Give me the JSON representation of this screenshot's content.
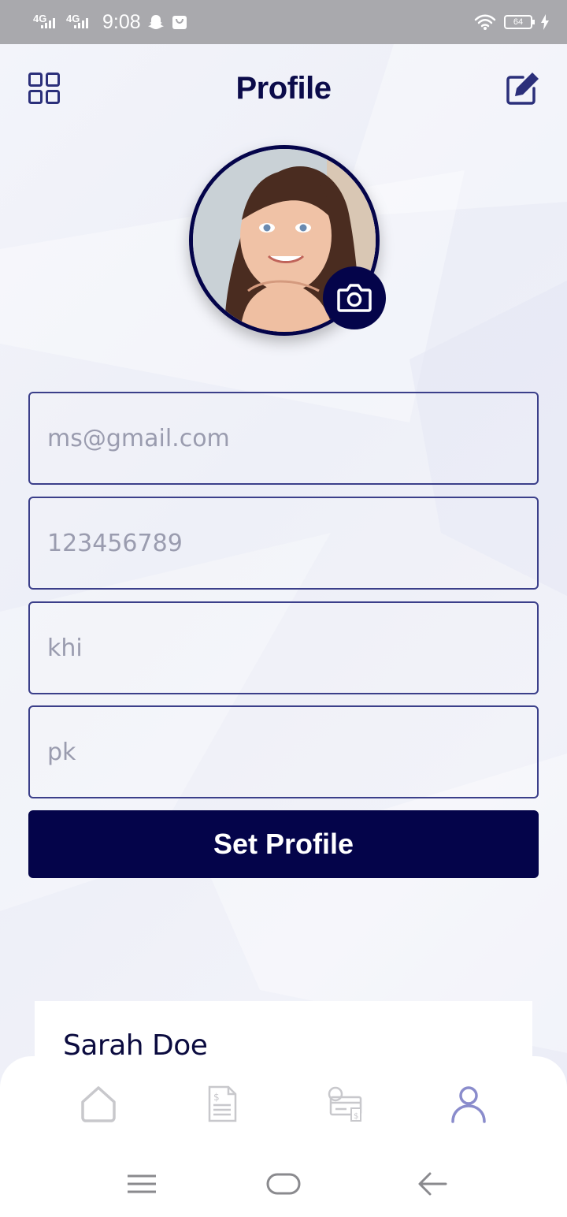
{
  "status_bar": {
    "network_1": "4G",
    "network_2": "4G",
    "time": "9:08",
    "battery": "64"
  },
  "header": {
    "title": "Profile",
    "menu_icon": "grid-icon",
    "edit_icon": "edit-icon"
  },
  "profile": {
    "camera_icon": "camera-icon"
  },
  "form": {
    "email_placeholder": "ms@gmail.com",
    "phone_placeholder": "123456789",
    "city_placeholder": "khi",
    "country_placeholder": "pk",
    "submit_label": "Set Profile"
  },
  "card": {
    "name": "Sarah Doe"
  },
  "bottom_nav": {
    "items": [
      {
        "icon": "home-icon",
        "active": false
      },
      {
        "icon": "invoice-icon",
        "active": false
      },
      {
        "icon": "payment-icon",
        "active": false
      },
      {
        "icon": "user-icon",
        "active": true
      }
    ]
  },
  "colors": {
    "primary": "#04044a",
    "border": "#3b3f8a",
    "placeholder": "#9a9caf",
    "active_nav": "#8a8ccc",
    "inactive_nav": "#c8c8cc"
  }
}
